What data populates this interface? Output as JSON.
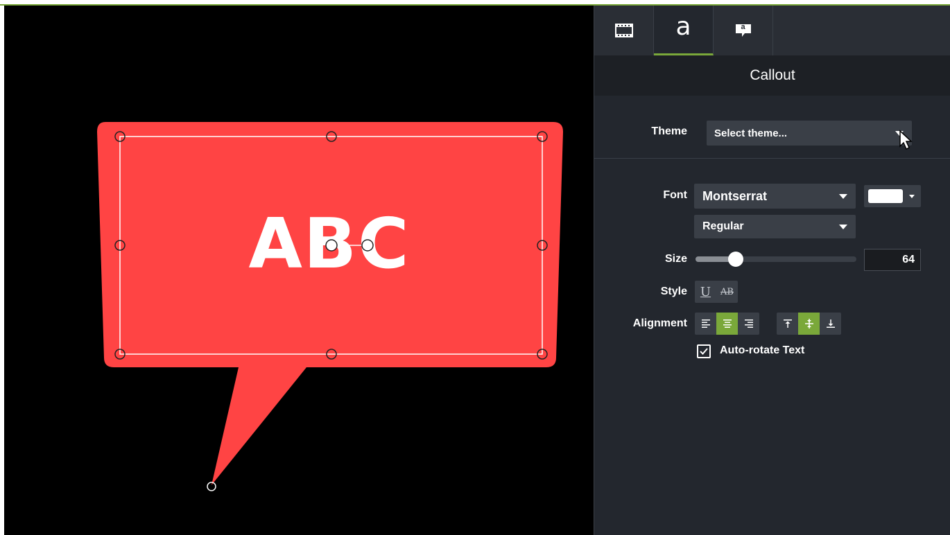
{
  "canvas": {
    "callout_text": "ABC",
    "callout_color": "#ff4444",
    "background": "#000000"
  },
  "panel": {
    "tabs": [
      {
        "name": "visual-properties",
        "icon": "film-strip-icon"
      },
      {
        "name": "text-properties",
        "label": "a",
        "icon": "text-icon"
      },
      {
        "name": "callout-properties",
        "label": "a",
        "icon": "callout-icon"
      }
    ],
    "header": "Callout",
    "theme": {
      "label": "Theme",
      "value": "Select theme..."
    },
    "font": {
      "label": "Font",
      "family": "Montserrat",
      "weight": "Regular",
      "color": "#ffffff"
    },
    "size": {
      "label": "Size",
      "value": "64",
      "slider_fraction": 0.25
    },
    "style": {
      "label": "Style",
      "underline": "U",
      "strikethrough": "AB"
    },
    "alignment": {
      "label": "Alignment",
      "horizontal": [
        "left",
        "center",
        "right"
      ],
      "horizontal_active": "center",
      "vertical": [
        "top",
        "middle",
        "bottom"
      ],
      "vertical_active": "middle"
    },
    "auto_rotate": {
      "label": "Auto-rotate Text",
      "checked": true
    },
    "accent_color": "#7aa83a"
  }
}
